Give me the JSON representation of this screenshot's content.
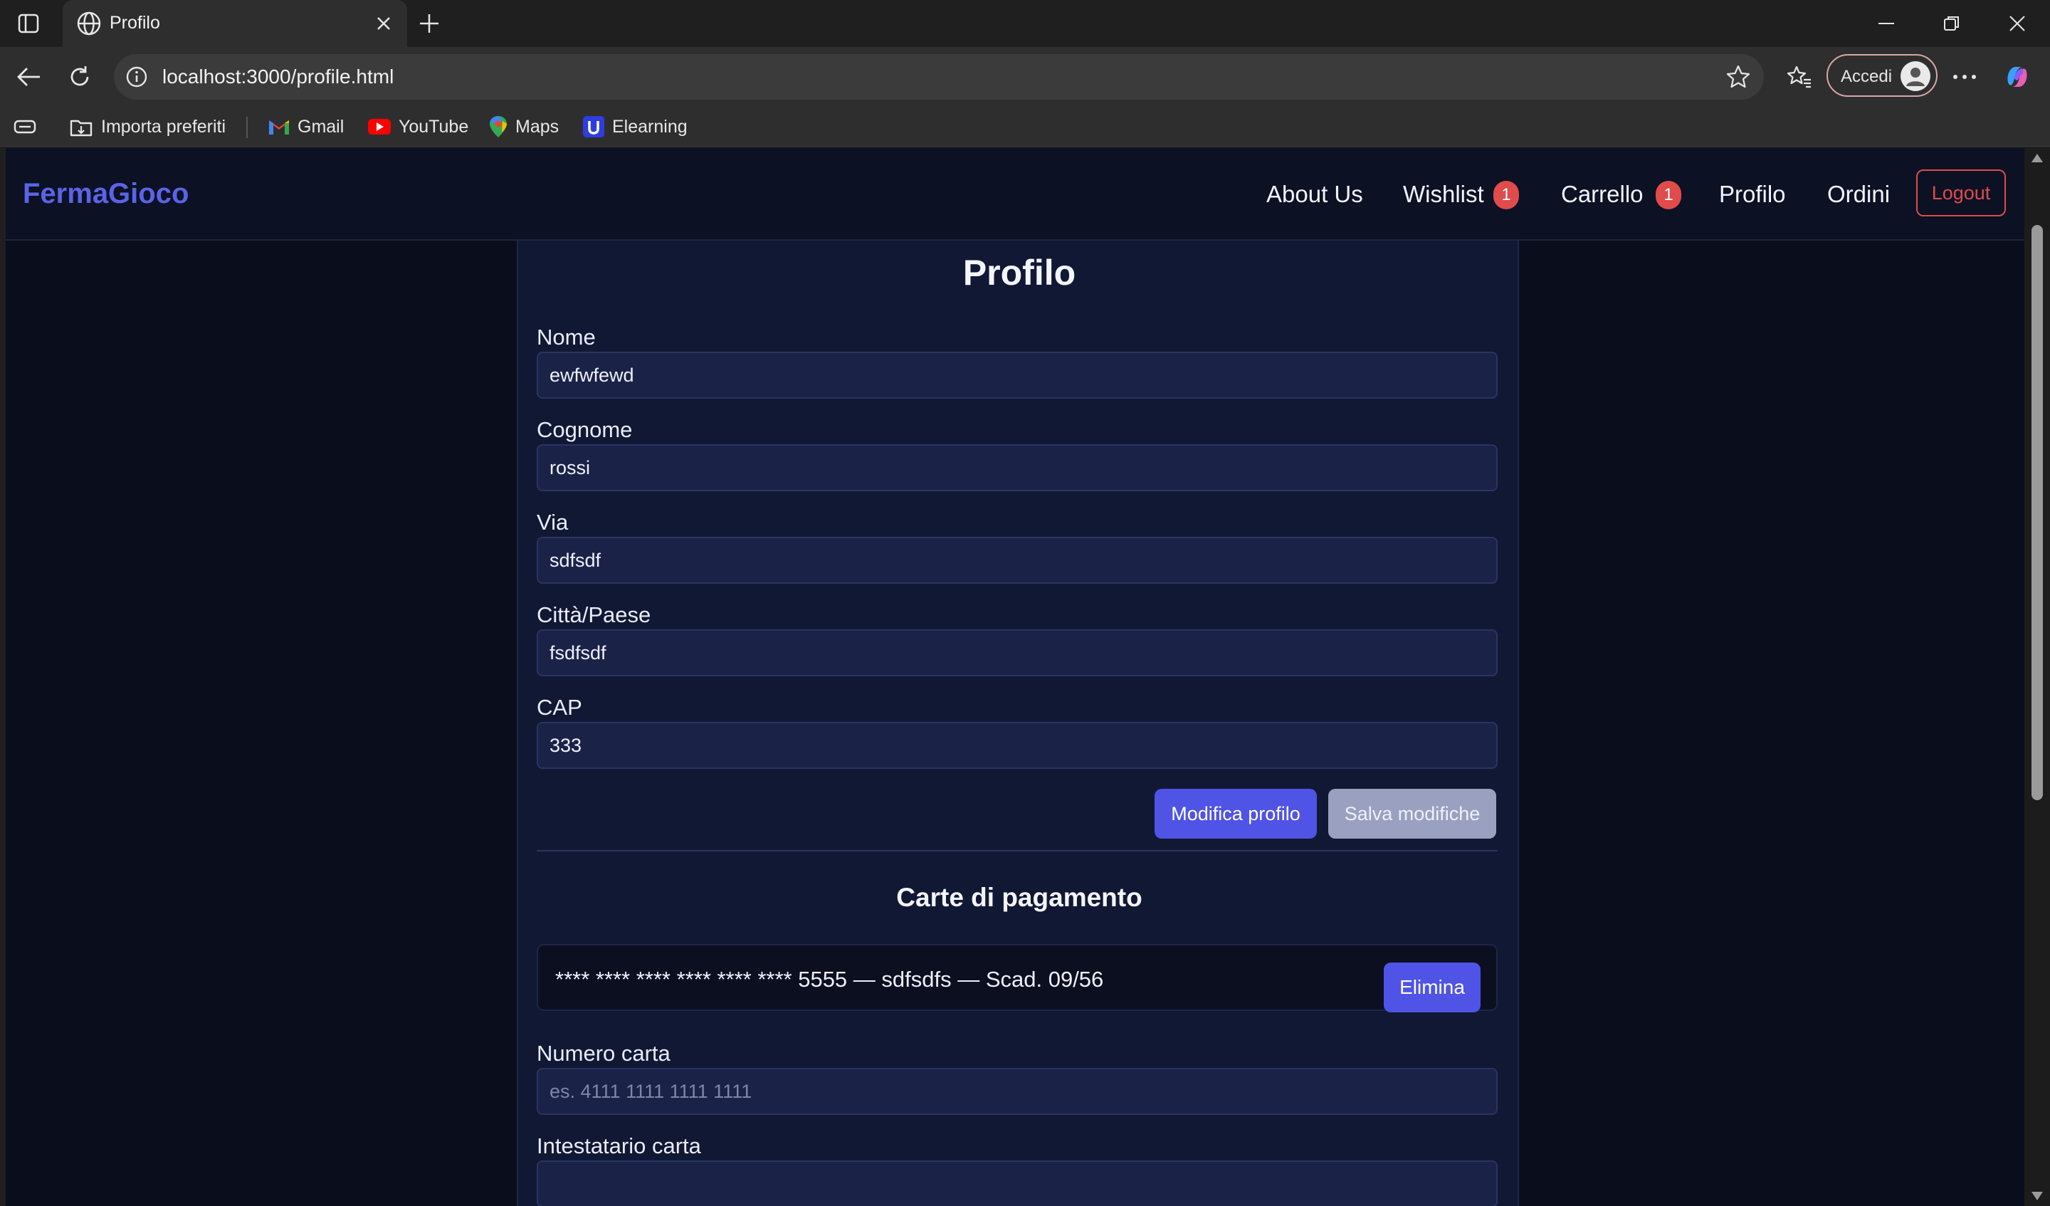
{
  "browser": {
    "tab_title": "Profilo",
    "url": "localhost:3000/profile.html",
    "account_label": "Accedi",
    "bookmarks": [
      "Importa preferiti",
      "Gmail",
      "YouTube",
      "Maps",
      "Elearning"
    ]
  },
  "site": {
    "brand": "FermaGioco",
    "nav": {
      "about": "About Us",
      "wishlist": "Wishlist",
      "wishlist_count": "1",
      "cart": "Carrello",
      "cart_count": "1",
      "profile": "Profilo",
      "orders": "Ordini",
      "logout": "Logout"
    },
    "colors": {
      "brand": "#5b63e6",
      "badge": "#e04b4b",
      "primary_button": "#4f54e6"
    }
  },
  "profile": {
    "title": "Profilo",
    "fields": {
      "nome_label": "Nome",
      "nome_value": "ewfwfewd",
      "cognome_label": "Cognome",
      "cognome_value": "rossi",
      "via_label": "Via",
      "via_value": "sdfsdf",
      "citta_label": "Città/Paese",
      "citta_value": "fsdfsdf",
      "cap_label": "CAP",
      "cap_value": "333"
    },
    "edit_button": "Modifica profilo",
    "save_button": "Salva modifiche"
  },
  "payments": {
    "title": "Carte di pagamento",
    "saved_card": "**** **** **** **** **** **** 5555 — sdfsdfs — Scad. 09/56",
    "delete_button": "Elimina",
    "card_number_label": "Numero carta",
    "card_number_placeholder": "es. 4111 1111 1111 1111",
    "holder_label": "Intestatario carta",
    "holder_value": ""
  }
}
